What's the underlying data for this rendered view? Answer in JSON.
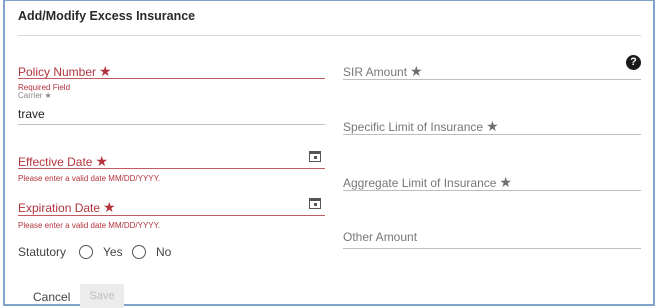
{
  "title": "Add/Modify Excess Insurance",
  "policy": {
    "label": "Policy Number",
    "error": "Required Field"
  },
  "carrier": {
    "label": "Carrier",
    "value": "trave"
  },
  "effective": {
    "label": "Effective Date",
    "error": "Please enter a valid date MM/DD/YYYY."
  },
  "expiration": {
    "label": "Expiration Date",
    "error": "Please enter a valid date MM/DD/YYYY."
  },
  "statutory": {
    "label": "Statutory",
    "options": [
      "Yes",
      "No"
    ]
  },
  "right": {
    "sir": "SIR Amount",
    "specific": "Specific Limit of Insurance",
    "aggregate": "Aggregate Limit of Insurance",
    "other": "Other Amount"
  },
  "help_symbol": "?",
  "buttons": {
    "cancel": "Cancel",
    "save": "Save"
  },
  "colors": {
    "error": "#b3343d",
    "frame": "#7fa3c9"
  }
}
